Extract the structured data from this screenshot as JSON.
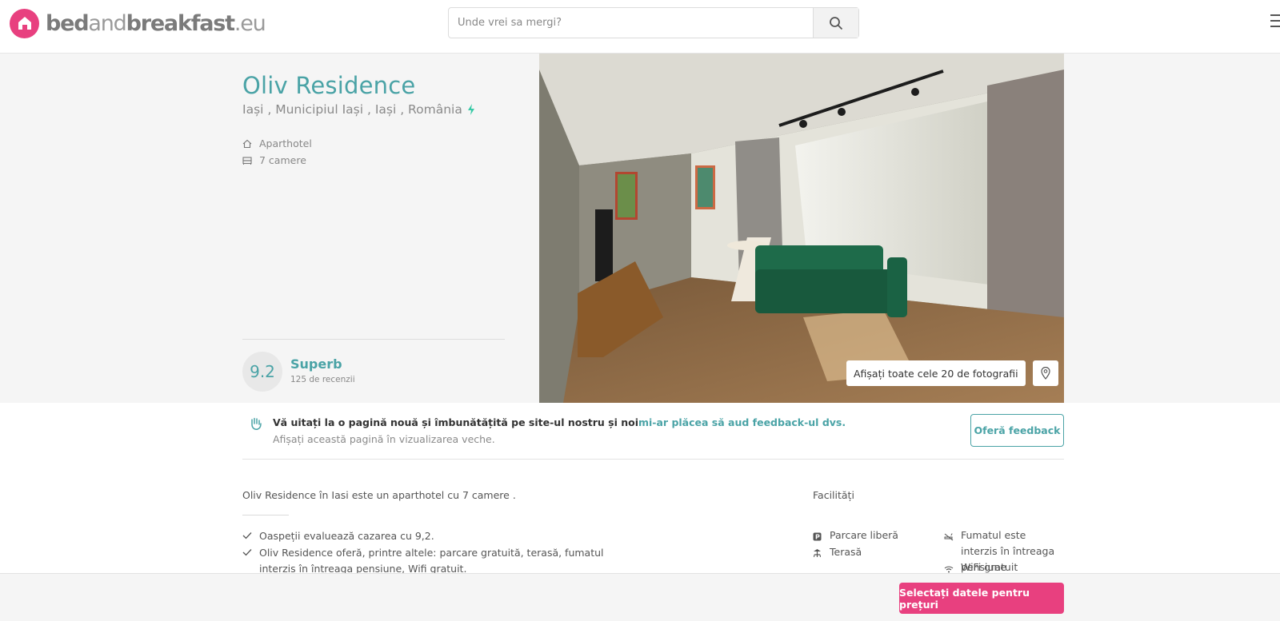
{
  "header": {
    "logo": {
      "part1": "bed",
      "part2": "and",
      "part3": "breakfast",
      "part4": ".eu"
    },
    "search": {
      "placeholder": "Unde vrei sa mergi?"
    },
    "search_icon": "search-icon",
    "menu_icon": "hamburger-menu-icon"
  },
  "property": {
    "name": "Oliv Residence",
    "location": "Iași , Municipiul Iași , Iași , România",
    "type": "Aparthotel",
    "rooms": "7 camere",
    "rating": {
      "score": "9.2",
      "label": "Superb",
      "reviews": "125 de recenzii"
    },
    "photos_button": "Afișați toate cele 20 de fotografii"
  },
  "feedback": {
    "text": "Vă uitați la o pagină nouă și îmbunătățită pe site-ul nostru și noi",
    "link": "mi-ar plăcea să aud feedback-ul dvs.",
    "old_view": "Afișați această pagină în vizualizarea veche.",
    "button": "Oferă feedback"
  },
  "description": {
    "intro": "Oliv Residence în Iasi este un aparthotel cu 7 camere .",
    "bullets": [
      "Oaspeții evaluează cazarea cu 9,2.",
      "Oliv Residence oferă, printre altele: parcare gratuită, terasă, fumatul interzis în întreaga pensiune, Wifi gratuit."
    ]
  },
  "facilities": {
    "title": "Facilități",
    "items": [
      "Parcare liberă",
      "Terasă",
      "Fumatul este interzis în întreaga pensiune",
      "WiFi gratuit"
    ]
  },
  "footer": {
    "cta": "Selectați datele pentru prețuri"
  },
  "colors": {
    "brand": "#e8407f",
    "accent": "#4aa3a6",
    "bolt": "#37c9a6"
  }
}
